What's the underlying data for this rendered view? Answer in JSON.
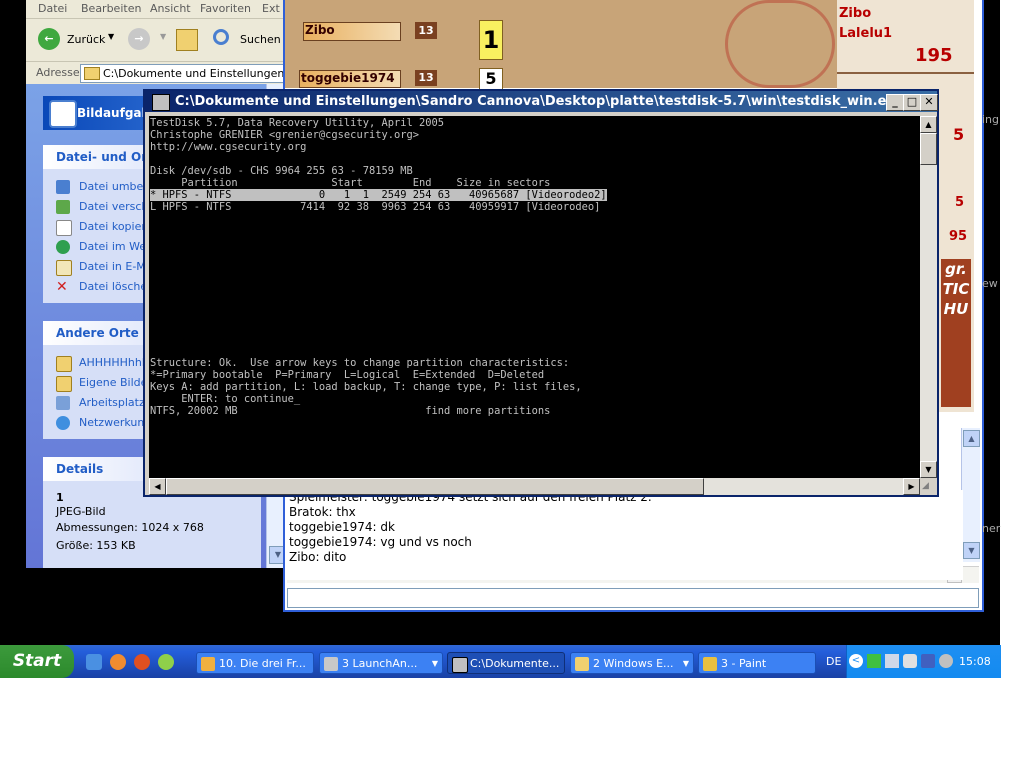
{
  "explorer": {
    "menu": [
      "Datei",
      "Bearbeiten",
      "Ansicht",
      "Favoriten",
      "Ext"
    ],
    "back_label": "Zurück",
    "search_label": "Suchen",
    "address_label": "Adresse",
    "address_value": "C:\\Dokumente und Einstellungen\\San",
    "tasks_title": "Bildaufgabe",
    "file_section": {
      "title": "Datei- und Ordn",
      "items": [
        "Datei umbene",
        "Datei verschi",
        "Datei kopiere",
        "Datei im Web",
        "Datei in E-Ma",
        "Datei löscher"
      ]
    },
    "places_section": {
      "title": "Andere Orte",
      "items": [
        "AHHHHHhhhh",
        "Eigene Bilder",
        "Arbeitsplatz",
        "Netzwerkumg"
      ]
    },
    "details_section": {
      "title": "Details",
      "name": "1",
      "type": "JPEG-Bild",
      "dimensions": "Abmessungen: 1024 x 768",
      "size": "Größe: 153 KB"
    }
  },
  "game": {
    "players": [
      {
        "name": "Zibo",
        "value": "13"
      },
      {
        "name": "toggebie1974",
        "value": "13"
      }
    ],
    "card1": "1",
    "card2": "5",
    "side_names": [
      "Zibo",
      "Lalelu1"
    ],
    "side_score": "195",
    "side_numbers": [
      "5",
      "5",
      "95"
    ],
    "side_vertical": "gr. TICHU",
    "chat_lines": [
      "Spielmeister: toggebie1974 setzt sich auf den freien Platz 2.",
      "Bratok: thx",
      "toggebie1974: dk",
      "toggebie1974: vg und vs noch",
      "Zibo: dito"
    ],
    "edge_labels": [
      "ing",
      "ew",
      "ner"
    ]
  },
  "console": {
    "title": "C:\\Dokumente und Einstellungen\\Sandro Cannova\\Desktop\\platte\\testdisk-5.7\\win\\testdisk_win.exe",
    "lines": [
      "TestDisk 5.7, Data Recovery Utility, April 2005",
      "Christophe GRENIER <grenier@cgsecurity.org>",
      "http://www.cgsecurity.org",
      "",
      "Disk /dev/sdb - CHS 9964 255 63 - 78159 MB",
      "     Partition               Start        End    Size in sectors",
      "* HPFS - NTFS              0   1  1  2549 254 63   40965687 [Videorodeo2]",
      "L HPFS - NTFS           7414  92 38  9963 254 63   40959917 [Videorodeo]",
      "Structure: Ok.  Use arrow keys to change partition characteristics:",
      "*=Primary bootable  P=Primary  L=Logical  E=Extended  D=Deleted",
      "Keys A: add partition, L: load backup, T: change type, P: list files,",
      "     ENTER: to continue_",
      "NTFS, 20002 MB                              find more partitions"
    ]
  },
  "taskbar": {
    "start_label": "Start",
    "tasks": [
      {
        "label": "10. Die drei Fr...",
        "icon": "firefox-icon"
      },
      {
        "label": "3 LaunchAn...",
        "icon": "app-icon"
      },
      {
        "label": "C:\\Dokumente...",
        "icon": "console-icon",
        "active": true
      },
      {
        "label": "2 Windows E...",
        "icon": "folder-icon"
      },
      {
        "label": "3 - Paint",
        "icon": "paint-icon"
      }
    ],
    "language": "DE",
    "clock": "15:08"
  }
}
